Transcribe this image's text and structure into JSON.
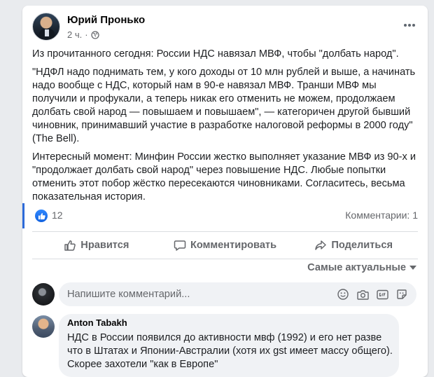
{
  "post": {
    "author": "Юрий Пронько",
    "time": "2 ч.",
    "separator": "·",
    "privacy_icon": "globe-icon",
    "more_icon": "more-options-icon",
    "paragraphs": [
      "Из прочитанного сегодня: России НДС навязал МВФ, чтобы \"долбать народ\".",
      "\"НДФЛ надо поднимать тем, у кого доходы от 10 млн рублей и выше, а начинать надо вообще с НДС, который нам в 90-е навязал МВФ. Транши МВФ мы получили и профукали, а теперь никак его отменить не можем, продолжаем долбать свой народ — повышаем и повышаем\", — категоричен другой бывший чиновник, принимавший участие в разработке налоговой реформы в 2000 году\" (The Bell).",
      "Интересный момент: Минфин России жестко выполняет указание МВФ из 90-х и \"продолжает долбать свой народ\" через повышение НДС. Любые попытки отменить этот побор жёстко пересекаются чиновниками. Согласитесь, весьма показательная история."
    ]
  },
  "reactions": {
    "icon": "like-reaction-icon",
    "count": "12",
    "comments_label": "Комментарии: 1"
  },
  "actions": {
    "like": "Нравится",
    "comment": "Комментировать",
    "share": "Поделиться"
  },
  "sort": {
    "label": "Самые актуальные"
  },
  "compose": {
    "placeholder": "Напишите комментарий..."
  },
  "comments": [
    {
      "author": "Anton Tabakh",
      "text": "НДС в России появился до активности мвф (1992) и его нет разве что в Штатах и Японии-Австралии (хотя их gst имеет массу общего). Скорее захотели \"как в Европе\""
    }
  ],
  "colors": {
    "accent": "#1877f2",
    "text": "#1c1e21",
    "secondary": "#65676b",
    "background": "#e9ebee"
  }
}
